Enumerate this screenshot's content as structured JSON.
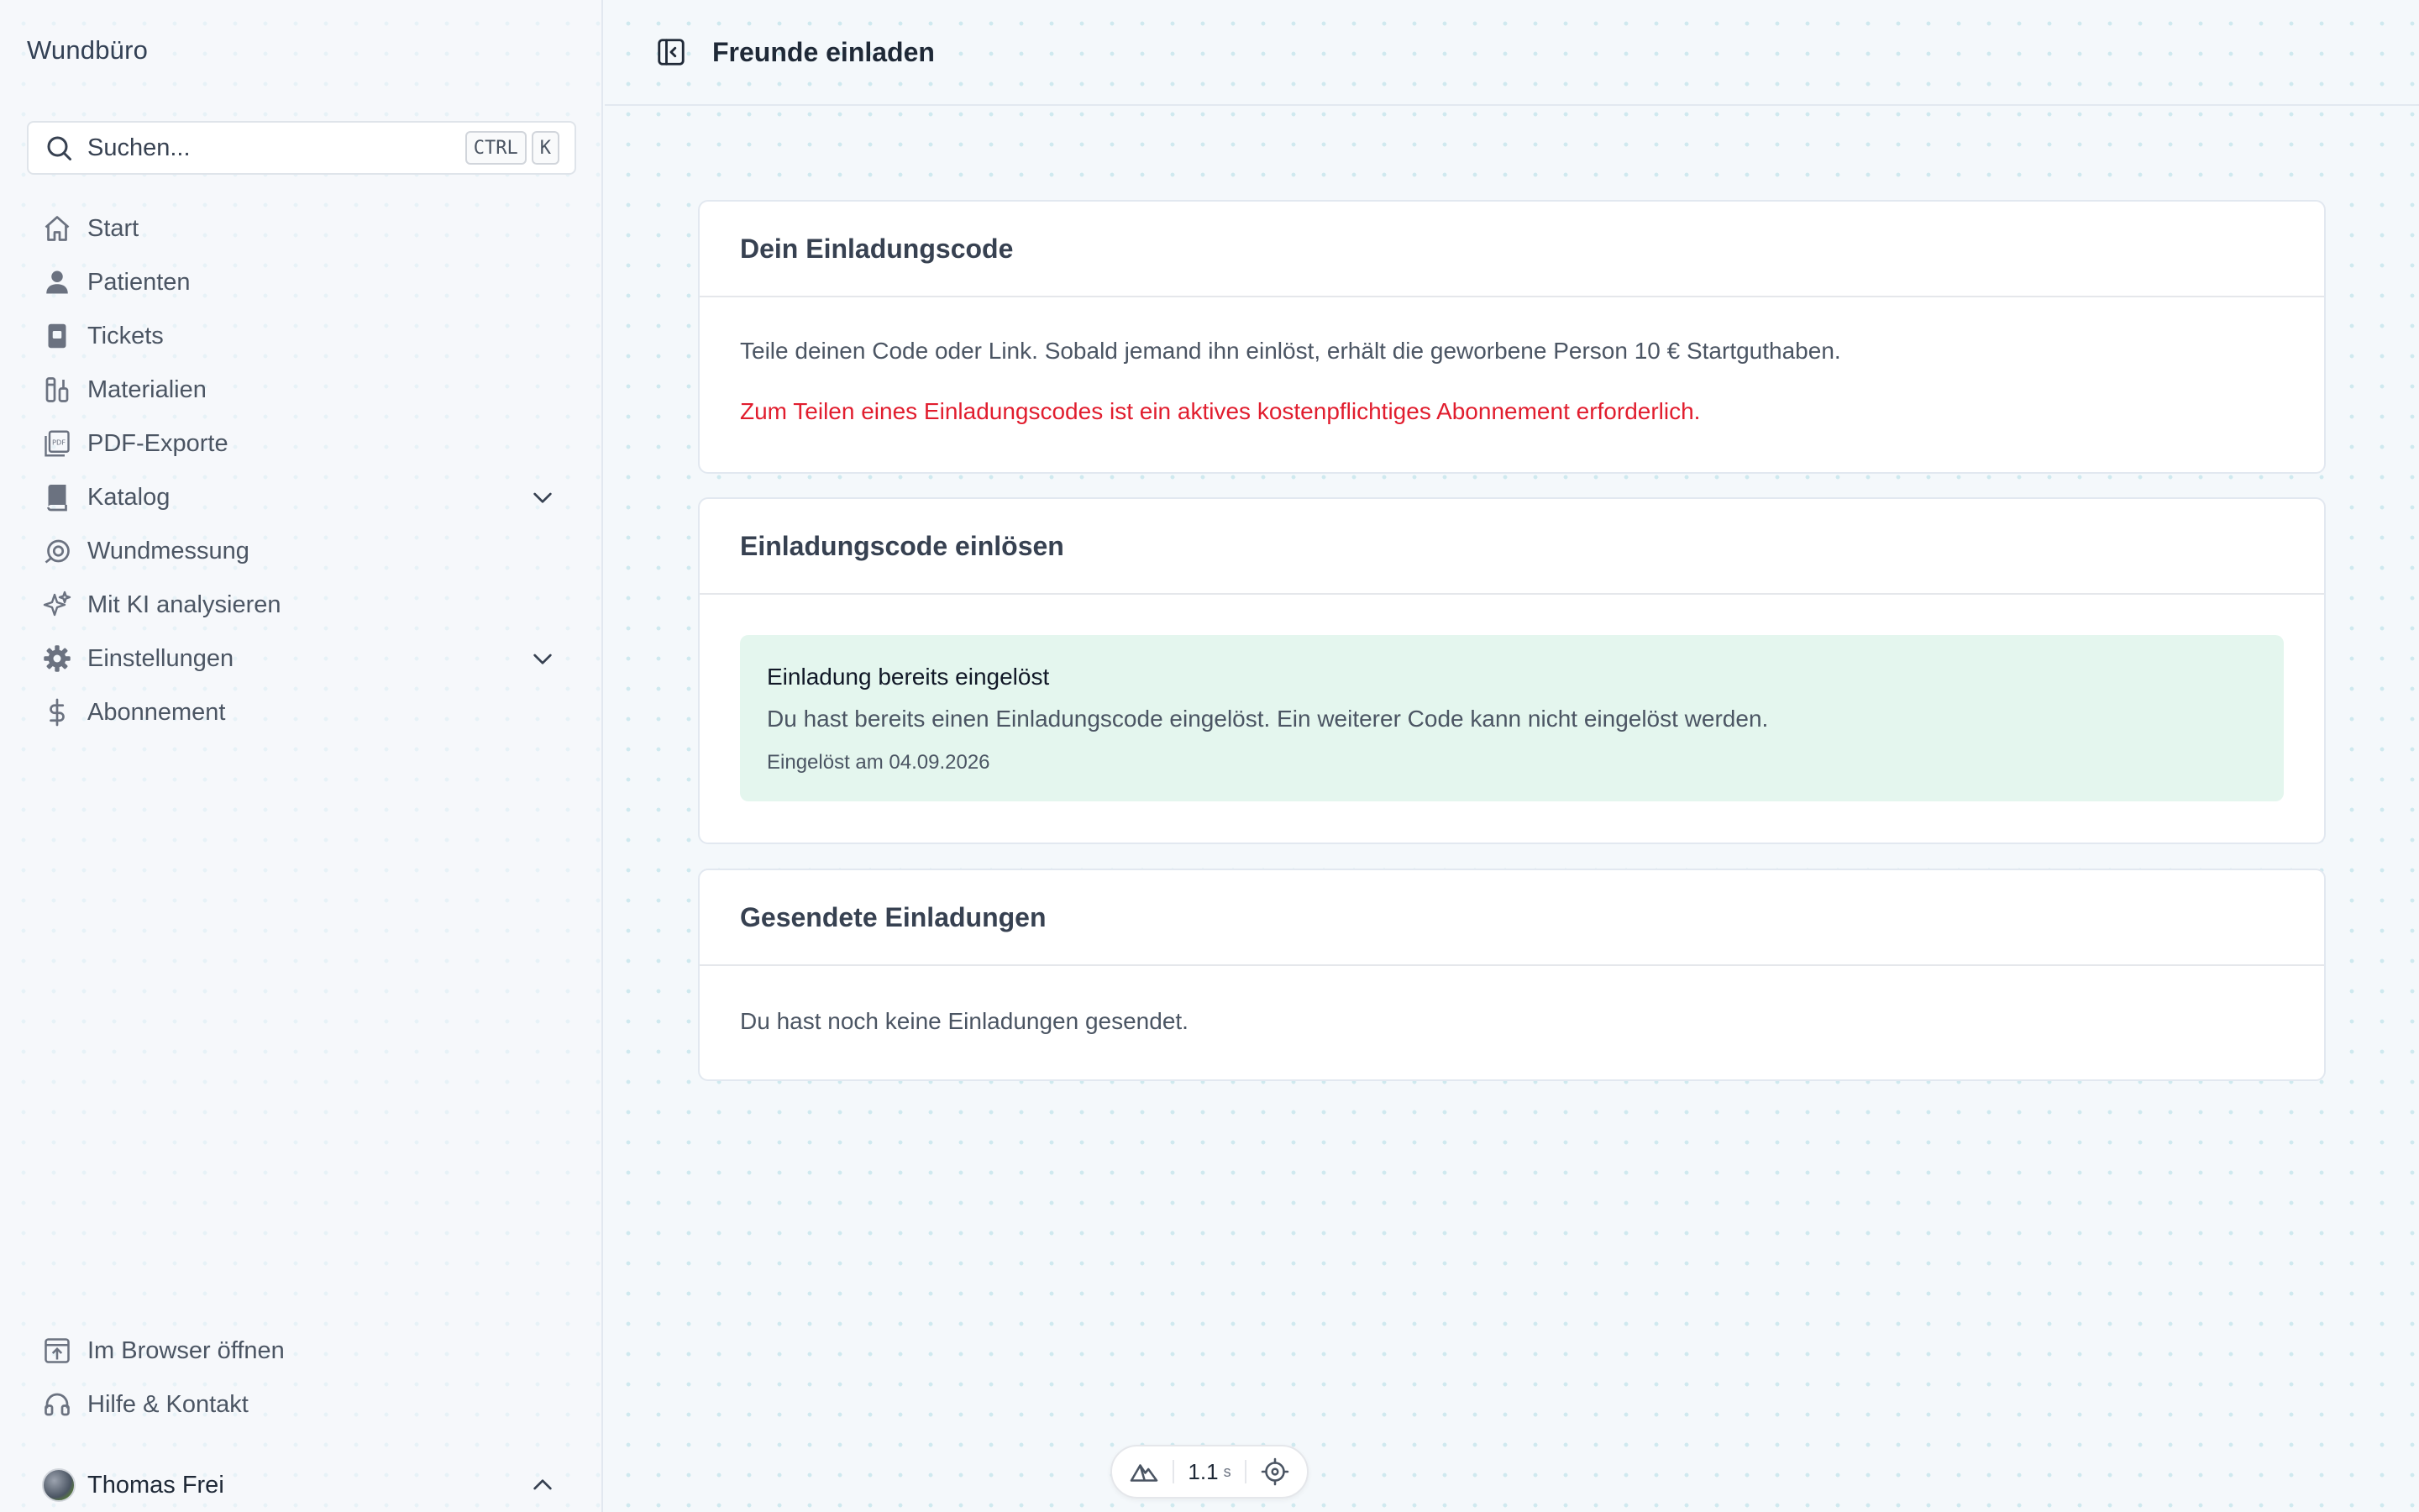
{
  "app": {
    "title": "Wundbüro"
  },
  "search": {
    "placeholder": "Suchen...",
    "shortcut_ctrl": "CTRL",
    "shortcut_key": "K"
  },
  "sidebar": {
    "items": [
      {
        "label": "Start",
        "icon": "home-icon"
      },
      {
        "label": "Patienten",
        "icon": "user-icon"
      },
      {
        "label": "Tickets",
        "icon": "ticket-icon"
      },
      {
        "label": "Materialien",
        "icon": "materials-icon"
      },
      {
        "label": "PDF-Exporte",
        "icon": "pdf-icon"
      },
      {
        "label": "Katalog",
        "icon": "book-icon",
        "expandable": true
      },
      {
        "label": "Wundmessung",
        "icon": "measure-icon"
      },
      {
        "label": "Mit KI analysieren",
        "icon": "sparkle-icon"
      },
      {
        "label": "Einstellungen",
        "icon": "gear-icon",
        "expandable": true
      },
      {
        "label": "Abonnement",
        "icon": "dollar-icon"
      }
    ],
    "bottom_items": [
      {
        "label": "Im Browser öffnen",
        "icon": "open-browser-icon"
      },
      {
        "label": "Hilfe & Kontakt",
        "icon": "headset-icon"
      }
    ],
    "user": {
      "name": "Thomas Frei"
    }
  },
  "header": {
    "title": "Freunde einladen"
  },
  "invite_code": {
    "title": "Dein Einladungscode",
    "description": "Teile deinen Code oder Link. Sobald jemand ihn einlöst, erhält die geworbene Person 10 € Startguthaben.",
    "error": "Zum Teilen eines Einladungscodes ist ein aktives kostenpflichtiges Abonnement erforderlich."
  },
  "redeem": {
    "title": "Einladungscode einlösen",
    "notice_title": "Einladung bereits eingelöst",
    "notice_text": "Du hast bereits einen Einladungscode eingelöst. Ein weiterer Code kann nicht eingelöst werden.",
    "notice_meta": "Eingelöst am 04.09.2026"
  },
  "sent": {
    "title": "Gesendete Einladungen",
    "empty": "Du hast noch keine Einladungen gesendet."
  },
  "status_pill": {
    "value": "1.1",
    "unit": "s"
  },
  "colors": {
    "error": "#e11d2e",
    "notice_bg": "#e4f6ee",
    "text_muted": "#4b5563"
  }
}
